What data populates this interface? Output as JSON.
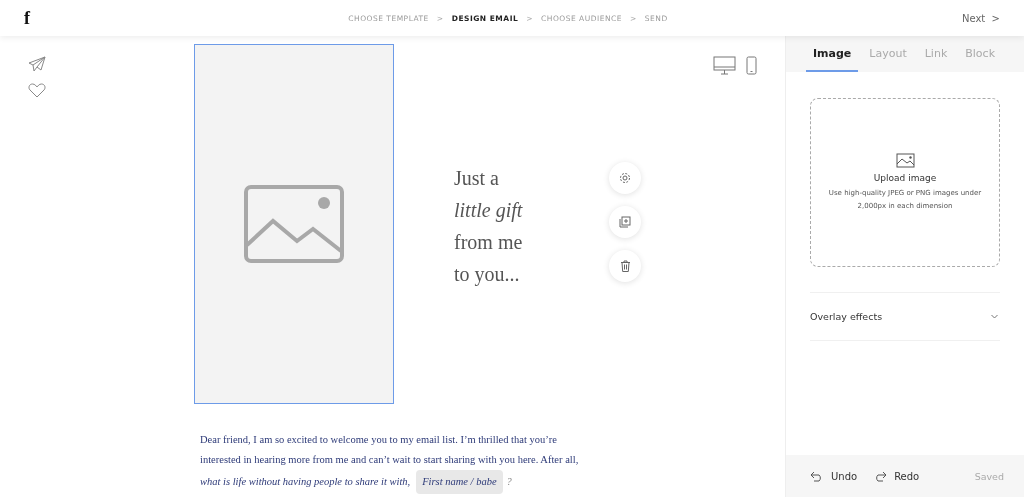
{
  "header": {
    "logo": "f",
    "steps": [
      {
        "label": "CHOOSE TEMPLATE",
        "selected": false,
        "separator": ">"
      },
      {
        "label": "DESIGN EMAIL",
        "selected": true,
        "separator": ">"
      },
      {
        "label": "CHOOSE AUDIENCE",
        "selected": false,
        "separator": ">"
      },
      {
        "label": "SEND",
        "selected": false
      }
    ],
    "next": {
      "label": "Next",
      "arrow": ">"
    }
  },
  "canvas": {
    "image_block": {
      "selected": true
    },
    "headline": "Just a\n*little gift*\nfrom me\nto you...",
    "paragraph": "Dear friend, I am so excited to welcome you to my email list. I’m thrilled that you’re interested in hearing more from me and can’t wait to start sharing with you here. After all,",
    "question": "what is life without having people to share it with,",
    "merge_tag": "First name / babe",
    "paragraph_end": "?"
  },
  "panel": {
    "tabs": [
      {
        "label": "Image",
        "selected": true
      },
      {
        "label": "Layout",
        "selected": false
      },
      {
        "label": "Link",
        "selected": false
      },
      {
        "label": "Block",
        "selected": false
      }
    ],
    "upload": {
      "title": "Upload image",
      "hint": "Use high-quality JPEG or PNG images under 2,000px in each dimension"
    },
    "sections": [
      {
        "label": "Overlay effects",
        "expanded": false
      }
    ],
    "footer": {
      "undo": "Undo",
      "redo": "Redo",
      "status": "Saved"
    }
  }
}
